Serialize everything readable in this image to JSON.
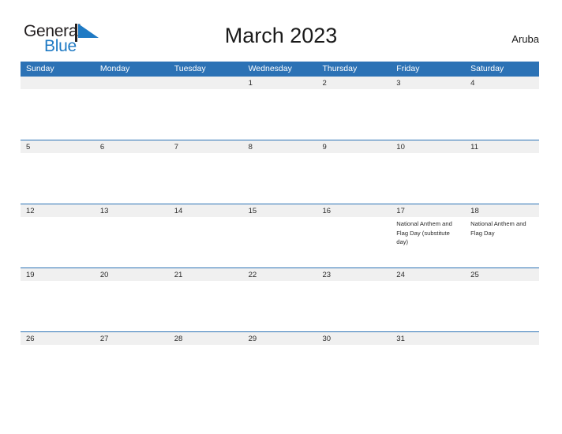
{
  "brand": {
    "name_part1": "General",
    "name_part2": "Blue",
    "flag_icon": "blue-triangle-flag-icon"
  },
  "header": {
    "title": "March 2023",
    "country": "Aruba"
  },
  "calendar": {
    "weekday_headers": [
      "Sunday",
      "Monday",
      "Tuesday",
      "Wednesday",
      "Thursday",
      "Friday",
      "Saturday"
    ],
    "colors": {
      "header_blue": "#2c72b5",
      "strip_gray": "#f0f0f0",
      "logo_blue": "#1f7ac4",
      "text_dark": "#2b2b2b"
    },
    "weeks": [
      {
        "days": [
          {
            "num": "",
            "event": ""
          },
          {
            "num": "",
            "event": ""
          },
          {
            "num": "",
            "event": ""
          },
          {
            "num": "1",
            "event": ""
          },
          {
            "num": "2",
            "event": ""
          },
          {
            "num": "3",
            "event": ""
          },
          {
            "num": "4",
            "event": ""
          }
        ]
      },
      {
        "days": [
          {
            "num": "5",
            "event": ""
          },
          {
            "num": "6",
            "event": ""
          },
          {
            "num": "7",
            "event": ""
          },
          {
            "num": "8",
            "event": ""
          },
          {
            "num": "9",
            "event": ""
          },
          {
            "num": "10",
            "event": ""
          },
          {
            "num": "11",
            "event": ""
          }
        ]
      },
      {
        "days": [
          {
            "num": "12",
            "event": ""
          },
          {
            "num": "13",
            "event": ""
          },
          {
            "num": "14",
            "event": ""
          },
          {
            "num": "15",
            "event": ""
          },
          {
            "num": "16",
            "event": ""
          },
          {
            "num": "17",
            "event": "National Anthem and Flag Day (substitute day)"
          },
          {
            "num": "18",
            "event": "National Anthem and Flag Day"
          }
        ]
      },
      {
        "days": [
          {
            "num": "19",
            "event": ""
          },
          {
            "num": "20",
            "event": ""
          },
          {
            "num": "21",
            "event": ""
          },
          {
            "num": "22",
            "event": ""
          },
          {
            "num": "23",
            "event": ""
          },
          {
            "num": "24",
            "event": ""
          },
          {
            "num": "25",
            "event": ""
          }
        ]
      },
      {
        "days": [
          {
            "num": "26",
            "event": ""
          },
          {
            "num": "27",
            "event": ""
          },
          {
            "num": "28",
            "event": ""
          },
          {
            "num": "29",
            "event": ""
          },
          {
            "num": "30",
            "event": ""
          },
          {
            "num": "31",
            "event": ""
          },
          {
            "num": "",
            "event": ""
          }
        ]
      }
    ]
  }
}
